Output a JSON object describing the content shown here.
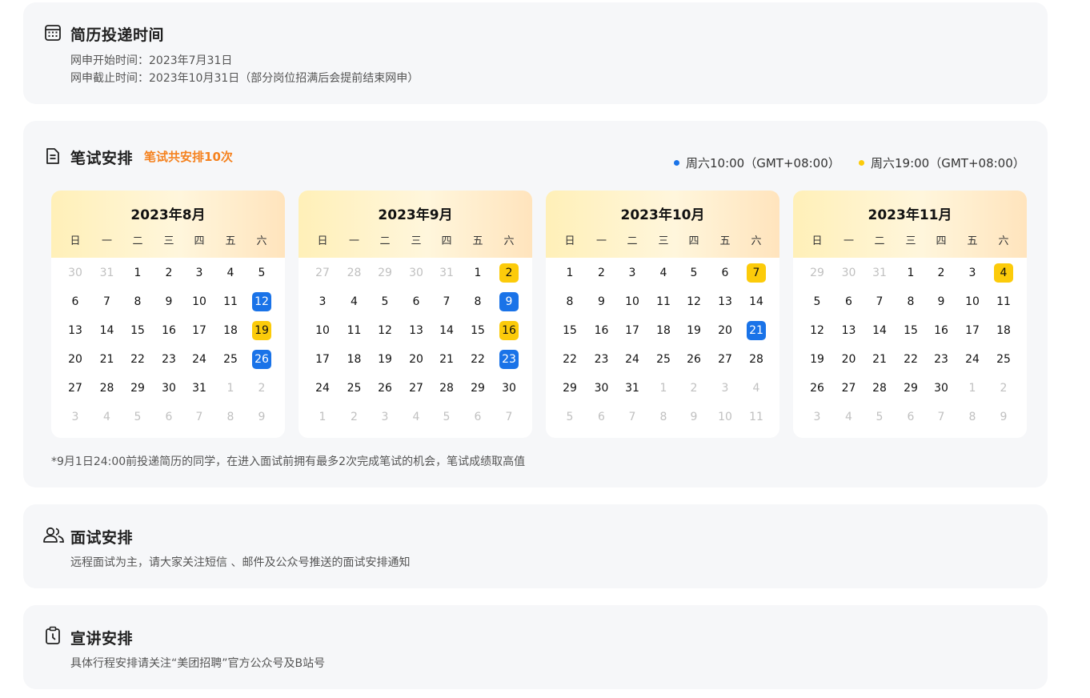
{
  "colors": {
    "accent_blue": "#1a73e8",
    "accent_yellow": "#fccb0a",
    "orange": "#f5821f",
    "card_bg": "#f6f7f9"
  },
  "resume": {
    "icon": "calendar-grid-icon",
    "title": "简历投递时间",
    "start": "网申开始时间：2023年7月31日",
    "end": "网申截止时间：2023年10月31日（部分岗位招满后会提前结束网申）"
  },
  "exam": {
    "icon": "document-icon",
    "title": "笔试安排",
    "subtitle": "笔试共安排10次",
    "legend": [
      {
        "label": "周六10:00（GMT+08:00）",
        "color": "#1a73e8"
      },
      {
        "label": "周六19:00（GMT+08:00）",
        "color": "#fccb0a"
      }
    ],
    "weekdays": [
      "日",
      "一",
      "二",
      "三",
      "四",
      "五",
      "六"
    ],
    "months": [
      {
        "title": "2023年8月",
        "lead": [
          30,
          31
        ],
        "count": 31,
        "trail": [
          1,
          2,
          3,
          4,
          5,
          6,
          7,
          8,
          9
        ],
        "blue": [
          12,
          26
        ],
        "yellow": [
          19
        ]
      },
      {
        "title": "2023年9月",
        "lead": [
          27,
          28,
          29,
          30,
          31
        ],
        "count": 30,
        "trail": [
          1,
          2,
          3,
          4,
          5,
          6,
          7
        ],
        "blue": [
          9,
          23
        ],
        "yellow": [
          2,
          16
        ]
      },
      {
        "title": "2023年10月",
        "lead": [],
        "count": 31,
        "trail": [
          1,
          2,
          3,
          4,
          5,
          6,
          7,
          8,
          9,
          10,
          11
        ],
        "blue": [
          21
        ],
        "yellow": [
          7
        ]
      },
      {
        "title": "2023年11月",
        "lead": [
          29,
          30,
          31
        ],
        "count": 30,
        "trail": [
          1,
          2,
          3,
          4,
          5,
          6,
          7,
          8,
          9
        ],
        "blue": [],
        "yellow": [
          4
        ]
      }
    ],
    "footnote": "*9月1日24:00前投递简历的同学，在进入面试前拥有最多2次完成笔试的机会，笔试成绩取高值"
  },
  "interview": {
    "icon": "users-icon",
    "title": "面试安排",
    "desc": "远程面试为主，请大家关注短信 、邮件及公众号推送的面试安排通知"
  },
  "talk": {
    "icon": "clipboard-clock-icon",
    "title": "宣讲安排",
    "desc": "具体行程安排请关注“美团招聘”官方公众号及B站号"
  }
}
